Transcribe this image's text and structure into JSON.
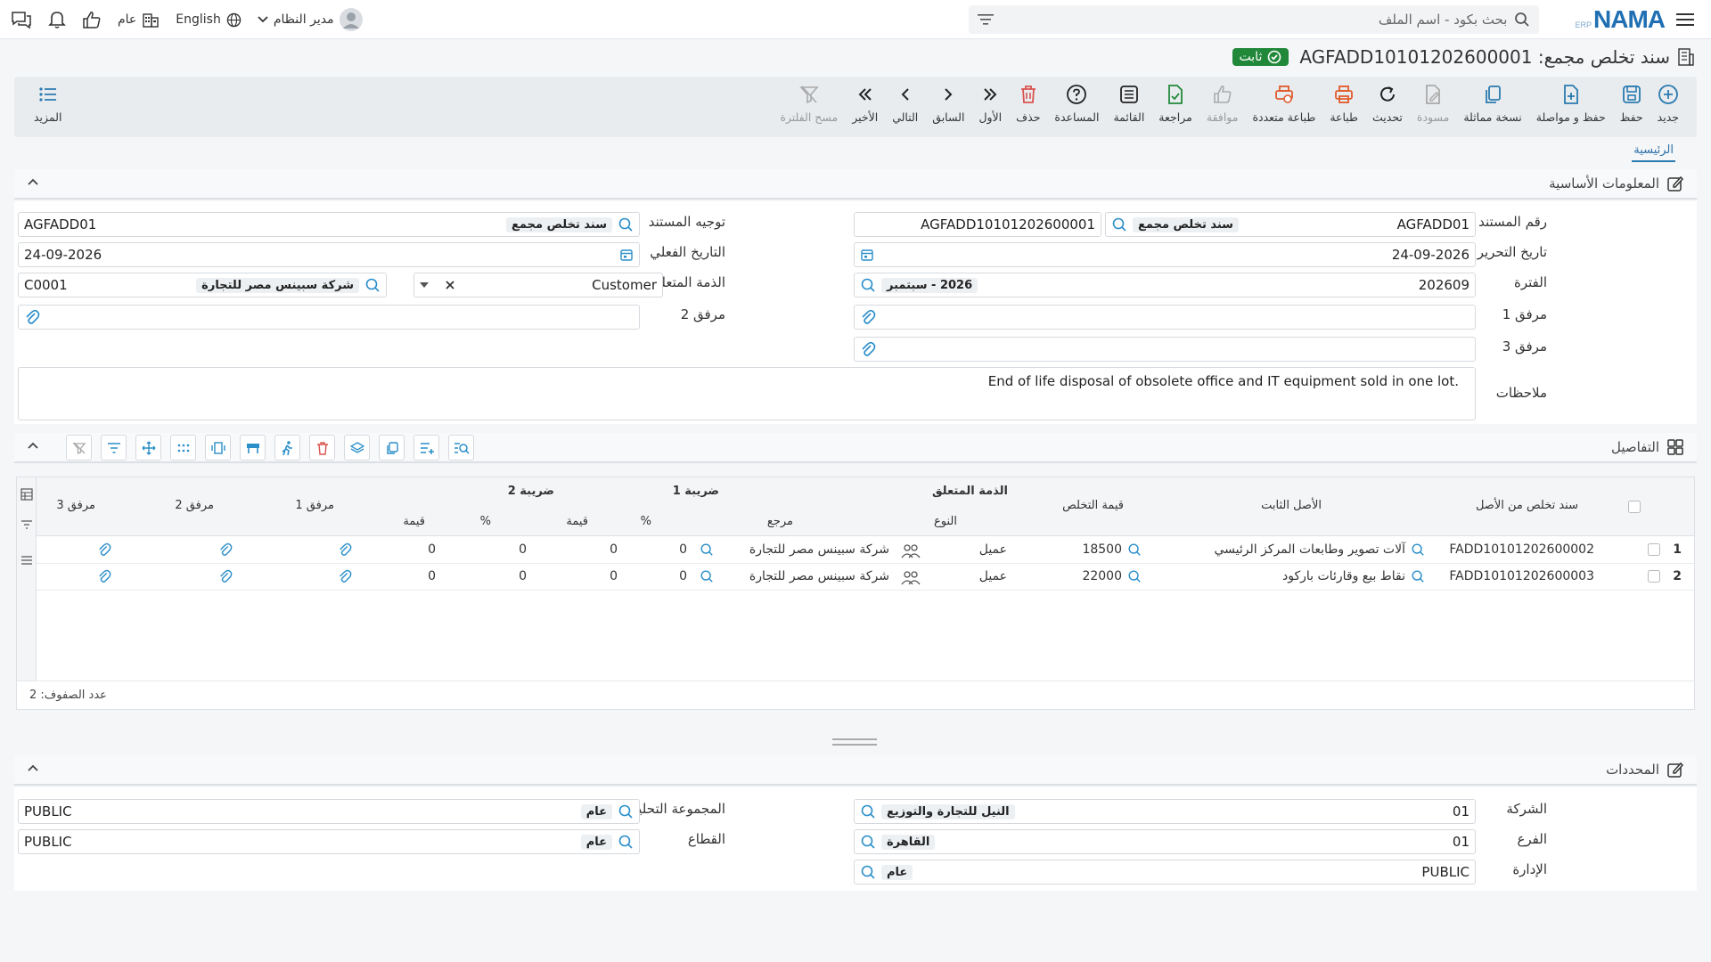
{
  "topbar": {
    "search_placeholder": "بحث بكود - اسم الملف",
    "language": "English",
    "scope": "عام",
    "user": "مدير النظام"
  },
  "title": {
    "text": "سند تخلص مجمع: AGFADD10101202600001",
    "status": "ثابت"
  },
  "toolbar": {
    "new": "جديد",
    "save": "حفظ",
    "save_continue": "حفظ و مواصلة",
    "duplicate": "نسخة مماثلة",
    "draft": "مسودة",
    "refresh": "تحديث",
    "print": "طباعة",
    "multi_print": "طباعة متعددة",
    "approve": "موافقة",
    "review": "مراجعة",
    "list": "القائمة",
    "help": "المساعدة",
    "delete": "حذف",
    "first": "الأول",
    "prev": "السابق",
    "next": "التالي",
    "last": "الأخير",
    "clear_filter": "مسح الفلترة",
    "more": "المزيد"
  },
  "tabs": {
    "main": "الرئيسية"
  },
  "basic": {
    "title": "المعلومات الأساسية",
    "doc_no_label": "رقم المستند",
    "doc_no_code": "AGFADD01",
    "doc_no_type": "سند تخلص مجمع",
    "doc_no_value": "AGFADD10101202600001",
    "doc_dir_label": "توجيه المستند",
    "doc_dir_code": "AGFADD01",
    "doc_dir_name": "سند تخلص مجمع",
    "edit_date_label": "تاريخ التحرير",
    "edit_date": "24-09-2026",
    "actual_date_label": "التاريخ الفعلي",
    "actual_date": "24-09-2026",
    "period_label": "الفترة",
    "period_code": "202609",
    "period_name": "2026 - سبتمبر",
    "subsidiary_label": "الذمة المتعلق",
    "subsidiary_type": "Customer",
    "subsidiary_code": "C0001",
    "subsidiary_name": "شركة سبينس مصر للتجارة",
    "att1_label": "مرفق 1",
    "att2_label": "مرفق 2",
    "att3_label": "مرفق 3",
    "notes_label": "ملاحظات",
    "notes": "End of life disposal of obsolete office and IT equipment sold in one lot."
  },
  "details": {
    "title": "التفاصيل",
    "headers": {
      "disposal_from_asset": "سند تخلص من الأصل",
      "fixed_asset": "الأصل الثابت",
      "disposal_value": "قيمة التخلص",
      "subsidiary_group": "الذمة المتعلق",
      "type": "النوع",
      "reference": "مرجع",
      "tax1": "ضريبة 1",
      "tax2": "ضريبة 2",
      "percent": "%",
      "value": "قيمة",
      "att1": "مرفق 1",
      "att2": "مرفق 2",
      "att3": "مرفق 3"
    },
    "rows": [
      {
        "n": "1",
        "code": "FADD10101202600002",
        "asset": "آلات تصوير وطابعات المركز الرئيسي",
        "value": "18500",
        "type": "عميل",
        "ref": "شركة سبينس مصر للتجارة",
        "t1p": "0",
        "t1v": "0",
        "t2p": "0",
        "t2v": "0"
      },
      {
        "n": "2",
        "code": "FADD10101202600003",
        "asset": "نقاط بيع وقارئات باركود",
        "value": "22000",
        "type": "عميل",
        "ref": "شركة سبينس مصر للتجارة",
        "t1p": "0",
        "t1v": "0",
        "t2p": "0",
        "t2v": "0"
      }
    ],
    "row_count": "عدد الصفوف: 2"
  },
  "dimensions": {
    "title": "المحددات",
    "company_label": "الشركة",
    "company_code": "01",
    "company_name": "النيل للتجارة والتوزيع",
    "branch_label": "الفرع",
    "branch_code": "01",
    "branch_name": "القاهرة",
    "dept_label": "الإدارة",
    "dept_code": "PUBLIC",
    "dept_name": "عام",
    "analytic_label": "المجموعة التحليلية",
    "analytic_code": "PUBLIC",
    "analytic_name": "عام",
    "sector_label": "القطاع",
    "sector_code": "PUBLIC",
    "sector_name": "عام"
  },
  "colors": {
    "accent": "#2a7ab0",
    "status_green": "#21883a",
    "print_red": "#e05a2a",
    "delete_red": "#d9534f"
  }
}
